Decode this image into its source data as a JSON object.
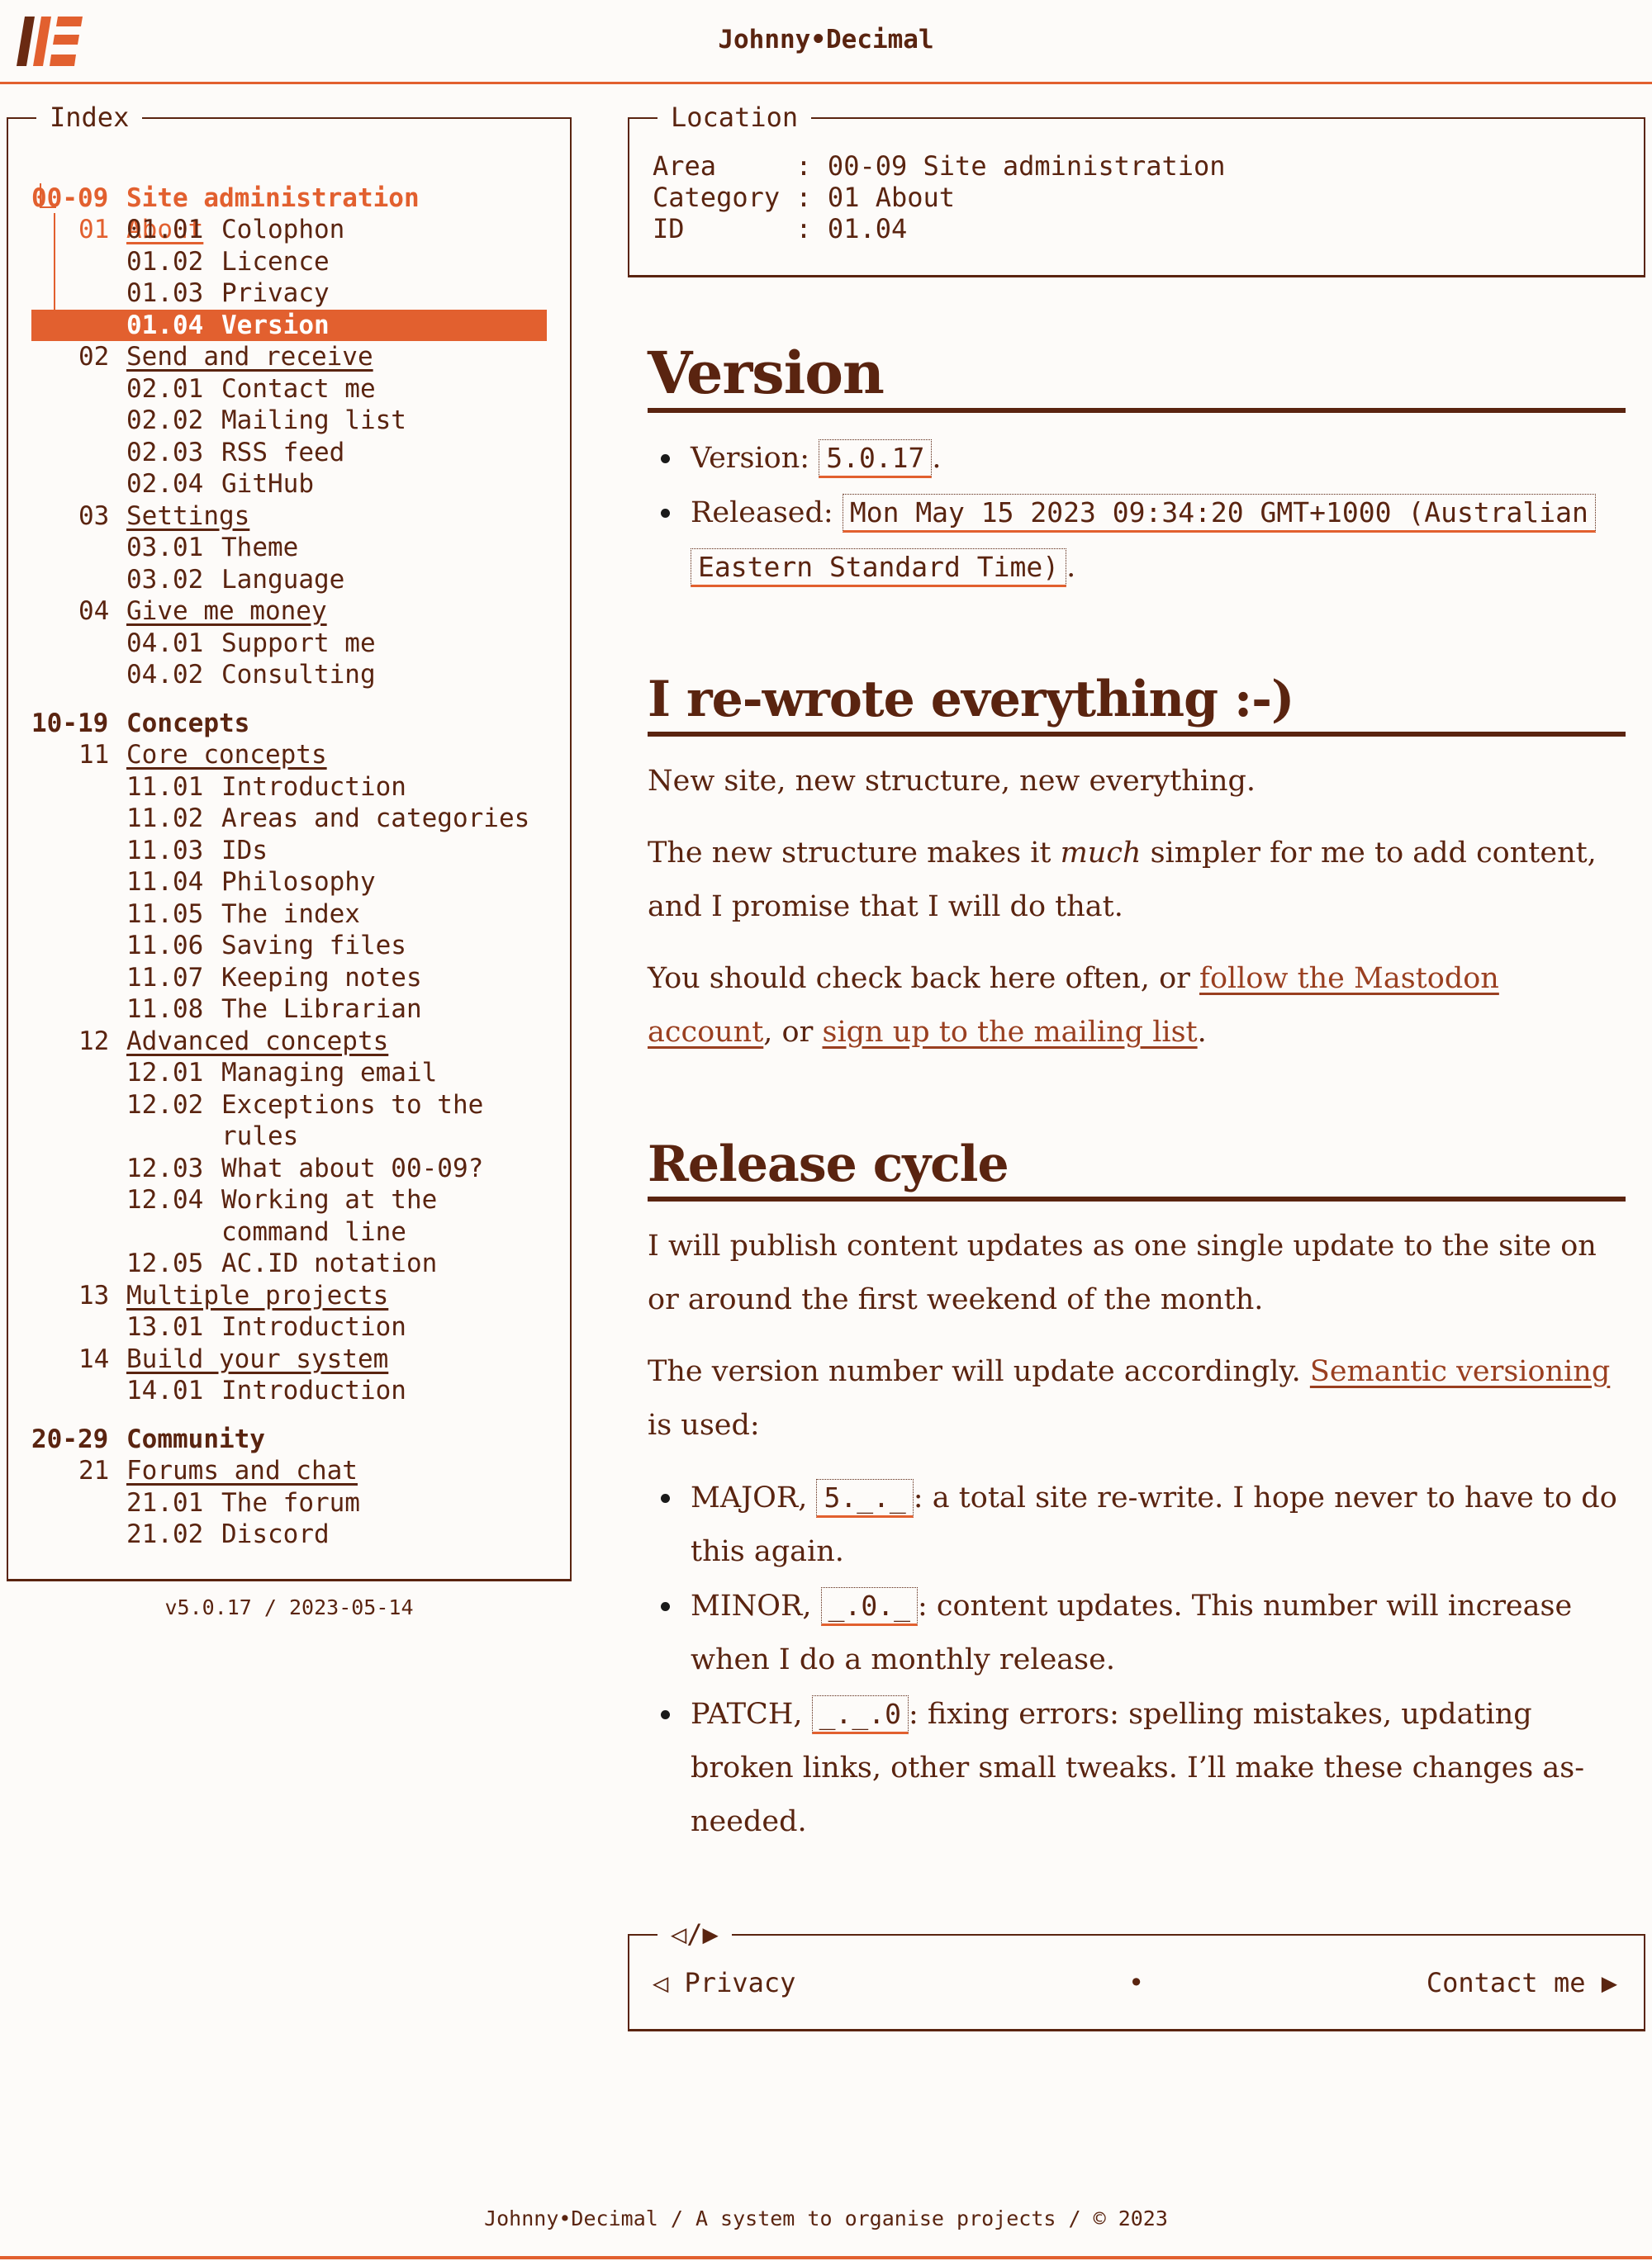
{
  "header": {
    "title": "Johnny•Decimal"
  },
  "index": {
    "label": "Index",
    "areas": [
      {
        "num": "00-09",
        "label": "Site administration",
        "categories": [
          {
            "num": "01",
            "label": "About",
            "items": [
              {
                "num": "01.01",
                "label": "Colophon"
              },
              {
                "num": "01.02",
                "label": "Licence"
              },
              {
                "num": "01.03",
                "label": "Privacy"
              },
              {
                "num": "01.04",
                "label": "Version"
              }
            ]
          },
          {
            "num": "02",
            "label": "Send and receive",
            "items": [
              {
                "num": "02.01",
                "label": "Contact me"
              },
              {
                "num": "02.02",
                "label": "Mailing list"
              },
              {
                "num": "02.03",
                "label": "RSS feed"
              },
              {
                "num": "02.04",
                "label": "GitHub"
              }
            ]
          },
          {
            "num": "03",
            "label": "Settings",
            "items": [
              {
                "num": "03.01",
                "label": "Theme"
              },
              {
                "num": "03.02",
                "label": "Language"
              }
            ]
          },
          {
            "num": "04",
            "label": "Give me money",
            "items": [
              {
                "num": "04.01",
                "label": "Support me"
              },
              {
                "num": "04.02",
                "label": "Consulting"
              }
            ]
          }
        ]
      },
      {
        "num": "10-19",
        "label": "Concepts",
        "categories": [
          {
            "num": "11",
            "label": "Core concepts",
            "items": [
              {
                "num": "11.01",
                "label": "Introduction"
              },
              {
                "num": "11.02",
                "label": "Areas and categories"
              },
              {
                "num": "11.03",
                "label": "IDs"
              },
              {
                "num": "11.04",
                "label": "Philosophy"
              },
              {
                "num": "11.05",
                "label": "The index"
              },
              {
                "num": "11.06",
                "label": "Saving files"
              },
              {
                "num": "11.07",
                "label": "Keeping notes"
              },
              {
                "num": "11.08",
                "label": "The Librarian"
              }
            ]
          },
          {
            "num": "12",
            "label": "Advanced concepts",
            "items": [
              {
                "num": "12.01",
                "label": "Managing email"
              },
              {
                "num": "12.02",
                "label": "Exceptions to the rules"
              },
              {
                "num": "12.03",
                "label": "What about 00-09?"
              },
              {
                "num": "12.04",
                "label": "Working at the command line"
              },
              {
                "num": "12.05",
                "label": "AC.ID notation"
              }
            ]
          },
          {
            "num": "13",
            "label": "Multiple projects",
            "items": [
              {
                "num": "13.01",
                "label": "Introduction"
              }
            ]
          },
          {
            "num": "14",
            "label": "Build your system",
            "items": [
              {
                "num": "14.01",
                "label": "Introduction"
              }
            ]
          }
        ]
      },
      {
        "num": "20-29",
        "label": "Community",
        "categories": [
          {
            "num": "21",
            "label": "Forums and chat",
            "items": [
              {
                "num": "21.01",
                "label": "The forum"
              },
              {
                "num": "21.02",
                "label": "Discord"
              }
            ]
          }
        ]
      }
    ],
    "version": "v5.0.17 / 2023-05-14"
  },
  "location": {
    "label": "Location",
    "area_key": "Area     : ",
    "area_val": "00-09 Site administration",
    "category_key": "Category : ",
    "category_val": "01 About",
    "id_key": "ID       : ",
    "id_val": "01.04"
  },
  "article": {
    "title": "Version",
    "version_label": "Version: ",
    "version_value": "5.0.17",
    "released_label": "Released: ",
    "released_value": "Mon May 15 2023 09:34:20 GMT+1000 (Australian Eastern Standard Time)",
    "s1_title": "I re-wrote everything :-)",
    "s1_p1": "New site, new structure, new everything.",
    "s1_p2_a": "The new structure makes it ",
    "s1_p2_em": "much",
    "s1_p2_b": " simpler for me to add content, and I promise that I will do that.",
    "s1_p3_a": "You should check back here often, or ",
    "s1_p3_link1": "follow the Mastodon account",
    "s1_p3_b": ", or ",
    "s1_p3_link2": "sign up to the mailing list",
    "s1_p3_c": ".",
    "s2_title": "Release cycle",
    "s2_p1": "I will publish content updates as one single update to the site on or around the first weekend of the month.",
    "s2_p2_a": "The version number will update accordingly. ",
    "s2_p2_link": "Semantic versioning",
    "s2_p2_b": " is used:",
    "major_label": "MAJOR, ",
    "major_code": "5._._",
    "major_text": ": a total site re-write. I hope never to have to do this again.",
    "minor_label": "MINOR, ",
    "minor_code": "_.0._",
    "minor_text": ": content updates. This number will increase when I do a monthly release.",
    "patch_label": "PATCH, ",
    "patch_code": "_._.0",
    "patch_text": ": fixing errors: spelling mistakes, updating broken links, other small tweaks. I’ll make these changes as-needed."
  },
  "nav": {
    "label": "◁/▶",
    "prev": "◁ Privacy",
    "dot": "•",
    "next": "Contact me ▶"
  },
  "footer": {
    "text": "Johnny•Decimal / A system to organise projects / © 2023"
  },
  "colors": {
    "background": "#fdfbf9",
    "ink": "#5a2410",
    "accent": "#e2602f",
    "link": "#9a3f20"
  },
  "icons": {
    "logo": "johnny-decimal-logo"
  }
}
